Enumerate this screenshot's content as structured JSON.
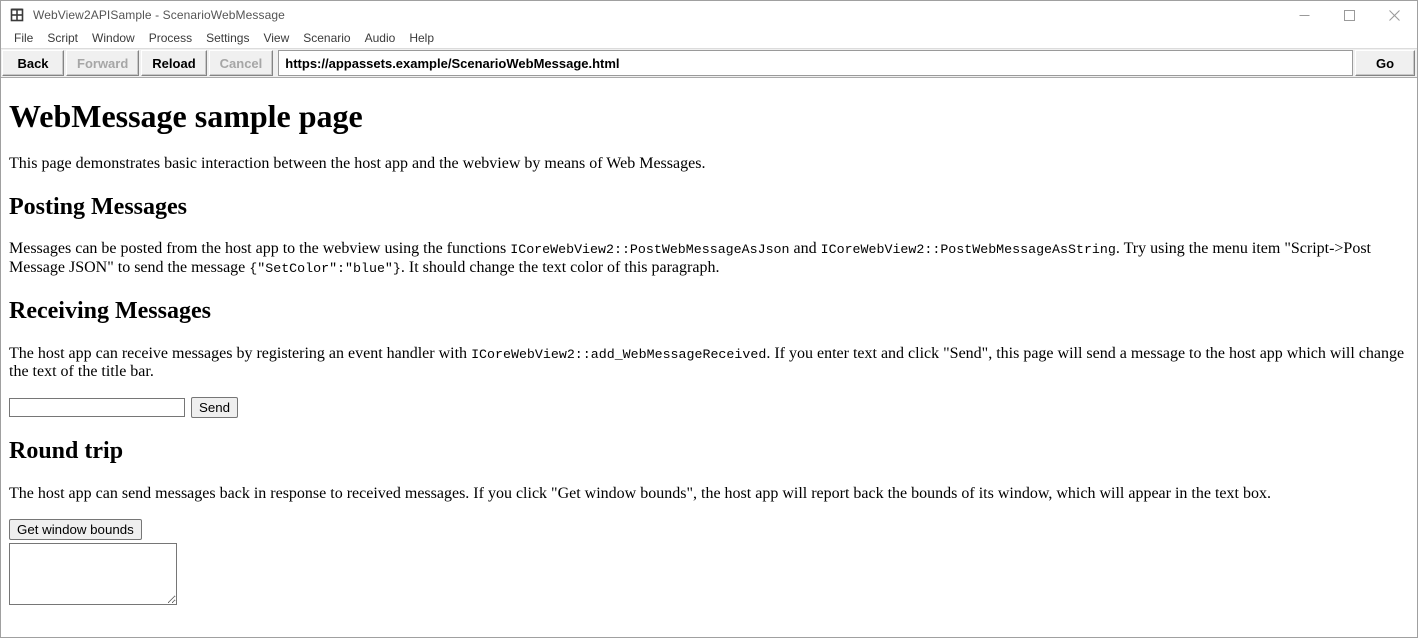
{
  "window": {
    "title": "WebView2APISample - ScenarioWebMessage",
    "app_icon": "grid-window-icon",
    "controls": {
      "minimize": "minimize-icon",
      "maximize": "maximize-icon",
      "close": "close-icon"
    }
  },
  "menubar": {
    "items": [
      {
        "label": "File"
      },
      {
        "label": "Script"
      },
      {
        "label": "Window"
      },
      {
        "label": "Process"
      },
      {
        "label": "Settings"
      },
      {
        "label": "View"
      },
      {
        "label": "Scenario"
      },
      {
        "label": "Audio"
      },
      {
        "label": "Help"
      }
    ]
  },
  "toolbar": {
    "back_label": "Back",
    "forward_label": "Forward",
    "reload_label": "Reload",
    "cancel_label": "Cancel",
    "go_label": "Go",
    "url_value": "https://appassets.example/ScenarioWebMessage.html",
    "url_placeholder": "",
    "disabled": [
      "Forward",
      "Cancel"
    ]
  },
  "page": {
    "title": "WebMessage sample page",
    "intro": "This page demonstrates basic interaction between the host app and the webview by means of Web Messages.",
    "posting": {
      "heading": "Posting Messages",
      "text_1": "Messages can be posted from the host app to the webview using the functions ",
      "code_1": "ICoreWebView2::PostWebMessageAsJson",
      "text_2": " and ",
      "code_2": "ICoreWebView2::PostWebMessageAsString",
      "text_3": ". Try using the menu item \"Script->Post Message JSON\" to send the message ",
      "code_3": "{\"SetColor\":\"blue\"}",
      "text_4": ". It should change the text color of this paragraph."
    },
    "receiving": {
      "heading": "Receiving Messages",
      "text_1": "The host app can receive messages by registering an event handler with ",
      "code_1": "ICoreWebView2::add_WebMessageReceived",
      "text_2": ". If you enter text and click \"Send\", this page will send a message to the host app which will change the text of the title bar.",
      "input_value": "",
      "input_placeholder": "",
      "send_label": "Send"
    },
    "round_trip": {
      "heading": "Round trip",
      "text": "The host app can send messages back in response to received messages. If you click \"Get window bounds\", the host app will report back the bounds of its window, which will appear in the text box.",
      "button_label": "Get window bounds",
      "textarea_value": "",
      "textarea_placeholder": ""
    }
  },
  "colors": {
    "window_border": "#a0a0a0",
    "toolbar_bg": "#f0f0f0",
    "disabled_text": "#a6a6a6",
    "menu_text": "#3b3b3b",
    "title_text": "#555555"
  }
}
